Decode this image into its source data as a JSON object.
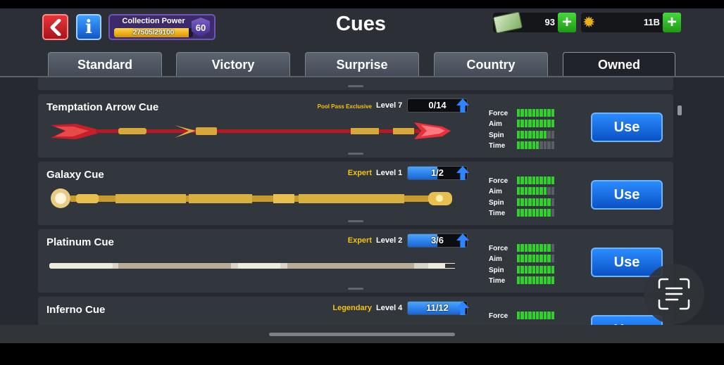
{
  "header": {
    "title": "Cues",
    "collection": {
      "label": "Collection Power",
      "value_text": "27505/29100",
      "progress": 0.945,
      "rank": "60"
    },
    "cash": {
      "amount": "93"
    },
    "coins": {
      "amount": "11B"
    }
  },
  "tabs": [
    {
      "label": "Standard",
      "active": false
    },
    {
      "label": "Victory",
      "active": false
    },
    {
      "label": "Surprise",
      "active": false
    },
    {
      "label": "Country",
      "active": false
    },
    {
      "label": "Owned",
      "active": true
    }
  ],
  "stat_labels": {
    "force": "Force",
    "aim": "Aim",
    "spin": "Spin",
    "time": "Time"
  },
  "cues": [
    {
      "name": "Temptation Arrow Cue",
      "tier": "Pool Pass Exclusive",
      "level": "Level 7",
      "progress": "0/14",
      "progress_fraction": 0.0,
      "stats": {
        "force": 10,
        "aim": 10,
        "spin": 8,
        "time": 6
      },
      "button": "Use",
      "style": "arrow"
    },
    {
      "name": "Galaxy Cue",
      "tier": "Expert",
      "level": "Level 1",
      "progress": "1/2",
      "progress_fraction": 0.5,
      "stats": {
        "force": 10,
        "aim": 8,
        "spin": 9,
        "time": 9
      },
      "button": "Use",
      "style": "galaxy"
    },
    {
      "name": "Platinum Cue",
      "tier": "Expert",
      "level": "Level 2",
      "progress": "3/6",
      "progress_fraction": 0.5,
      "stats": {
        "force": 9,
        "aim": 9,
        "spin": 10,
        "time": 10
      },
      "button": "Use",
      "style": "platinum"
    },
    {
      "name": "Inferno Cue",
      "tier": "Legendary",
      "level": "Level 4",
      "progress": "11/12",
      "progress_fraction": 0.917,
      "stats": {
        "force": 10
      },
      "button": "Use",
      "style": "inferno"
    }
  ],
  "colors": {
    "tier_gold": "#f4c311",
    "stat_on": "#2fd12a",
    "use_button": "#1a6fe8"
  },
  "icons": {
    "back": "chevron-left-icon",
    "info": "info-icon",
    "cash": "cash-icon",
    "coins": "gear-coin-icon",
    "plus": "plus-icon",
    "scan": "text-scan-icon"
  }
}
